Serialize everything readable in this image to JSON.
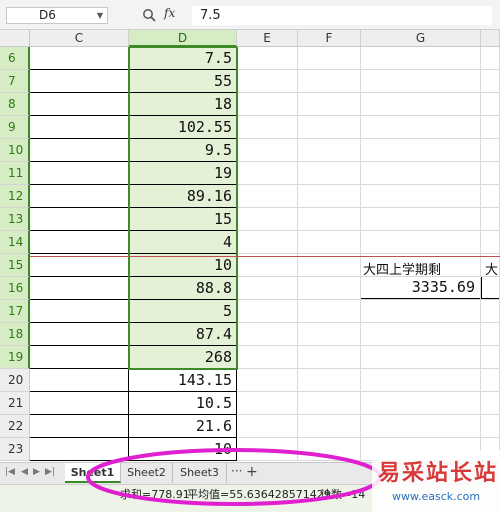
{
  "formula_bar": {
    "name_box": "D6",
    "fx_label": "fx",
    "formula_value": "7.5"
  },
  "columns": [
    "C",
    "D",
    "E",
    "F",
    "G"
  ],
  "rows": [
    {
      "num": "6",
      "d": "7.5"
    },
    {
      "num": "7",
      "d": "55"
    },
    {
      "num": "8",
      "d": "18"
    },
    {
      "num": "9",
      "d": "102.55"
    },
    {
      "num": "10",
      "d": "9.5"
    },
    {
      "num": "11",
      "d": "19"
    },
    {
      "num": "12",
      "d": "89.16"
    },
    {
      "num": "13",
      "d": "15"
    },
    {
      "num": "14",
      "d": "4"
    },
    {
      "num": "15",
      "d": "10"
    },
    {
      "num": "16",
      "d": "88.8"
    },
    {
      "num": "17",
      "d": "5"
    },
    {
      "num": "18",
      "d": "87.4"
    },
    {
      "num": "19",
      "d": "268"
    },
    {
      "num": "20",
      "d": "143.15"
    },
    {
      "num": "21",
      "d": "10.5"
    },
    {
      "num": "22",
      "d": "21.6"
    },
    {
      "num": "23",
      "d": "10"
    }
  ],
  "g_cells": {
    "g15_label": "大四上学期剩",
    "h15_label": "大",
    "g16_value": "3335.69"
  },
  "sheet_tabs": [
    "Sheet1",
    "Sheet2",
    "Sheet3"
  ],
  "add_sheet": "+",
  "more_tabs": "···",
  "status": {
    "sum": "求和=778.91",
    "average": "平均值=55.636428571429",
    "count": "计数=14"
  },
  "watermark": {
    "title": "易采站长站",
    "url": "www.easck.com"
  },
  "colors": {
    "selection_green": "#3e8a28",
    "selection_fill": "#e4f1d6",
    "annotation_magenta": "#e020d0",
    "freeze_line": "#c0504d"
  }
}
